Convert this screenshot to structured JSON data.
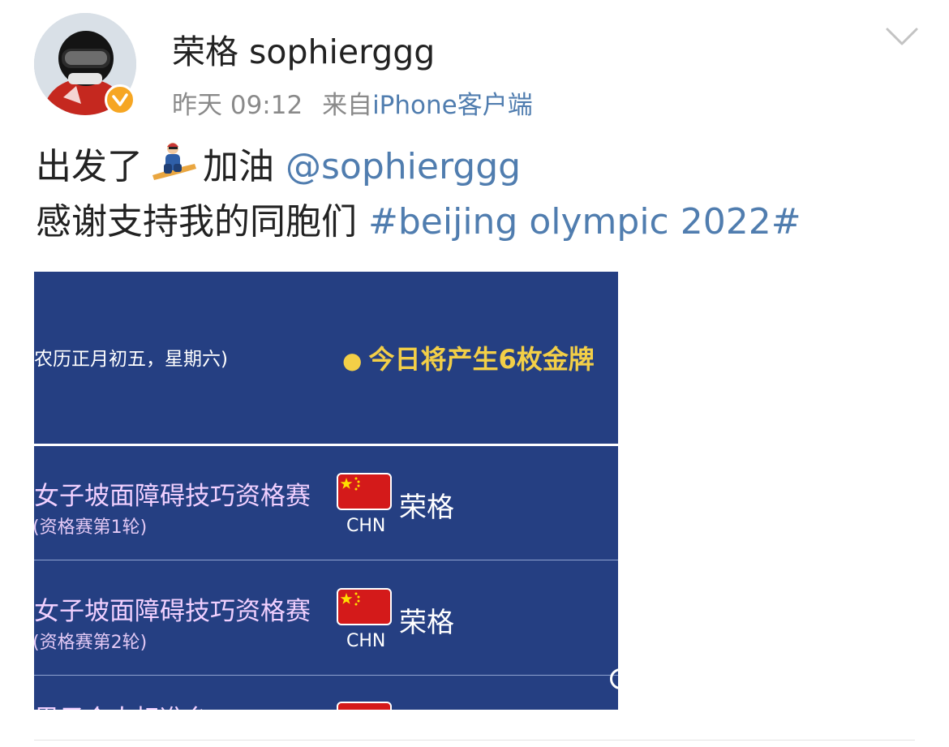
{
  "post": {
    "author": "荣格 sophierggg",
    "time": "昨天 09:12",
    "source_prefix": "来自",
    "source_link": "iPhone客户端",
    "verified_icon": "verified-badge-icon",
    "menu_icon": "chevron-down-icon",
    "line1_text_a": "出发了",
    "line1_emoji": "snowboarder-emoji",
    "line1_text_b": "加油",
    "mention": "@sophierggg",
    "line2_text": "感谢支持我的同胞们",
    "hashtag": "#beijing olympic 2022#"
  },
  "image": {
    "date_text": "农历正月初五，星期六)",
    "gold_text": "今日将产生6枚金牌",
    "events": [
      {
        "name": "女子坡面障碍技巧资格赛",
        "round": "(资格赛第1轮)",
        "country": "CHN",
        "athlete": "荣格"
      },
      {
        "name": "女子坡面障碍技巧资格赛",
        "round": "(资格赛第2轮)",
        "country": "CHN",
        "athlete": "荣格"
      }
    ],
    "partial_text": "男子个人标准台"
  },
  "colors": {
    "link": "#507daf",
    "image_bg": "#253f82",
    "gold": "#f3cf47",
    "event_name": "#f1d0ff",
    "flag_red": "#d41a1a",
    "badge": "#f6a623"
  }
}
